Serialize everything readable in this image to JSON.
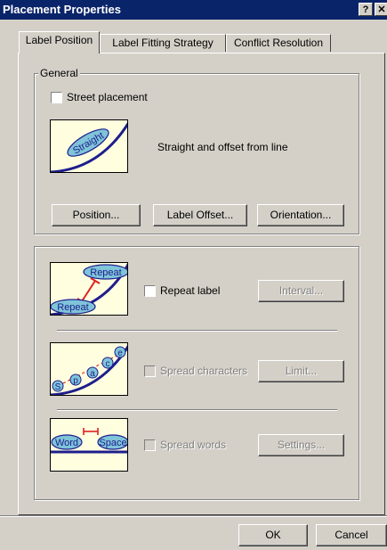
{
  "window": {
    "title": "Placement Properties",
    "help_label": "?",
    "close_label": "✕"
  },
  "tabs": [
    {
      "label": "Label Position"
    },
    {
      "label": "Label Fitting Strategy"
    },
    {
      "label": "Conflict Resolution"
    }
  ],
  "general": {
    "legend": "General",
    "street_placement_label": "Street placement",
    "street_placement_checked": false,
    "preview_text": "Straight",
    "description": "Straight and offset from line",
    "buttons": {
      "position": "Position...",
      "label_offset": "Label Offset...",
      "orientation": "Orientation..."
    }
  },
  "fitting": {
    "repeat": {
      "label": "Repeat label",
      "checked": false,
      "button": "Interval...",
      "pic_top": "Repeat",
      "pic_bottom": "Repeat"
    },
    "spread_chars": {
      "label": "Spread characters",
      "checked": false,
      "button": "Limit...",
      "pic_letters": [
        "S",
        "p",
        "a",
        "c",
        "e"
      ]
    },
    "spread_words": {
      "label": "Spread words",
      "checked": false,
      "button": "Settings...",
      "pic_word1": "Word",
      "pic_word2": "Space"
    }
  },
  "footer": {
    "ok_label": "OK",
    "cancel_label": "Cancel"
  },
  "colors": {
    "titlebar": "#0a246a",
    "picture_bg": "#ffffe0",
    "line": "#1e1e8c",
    "label_fill": "#7fc4d9",
    "accent": "#e02020"
  }
}
